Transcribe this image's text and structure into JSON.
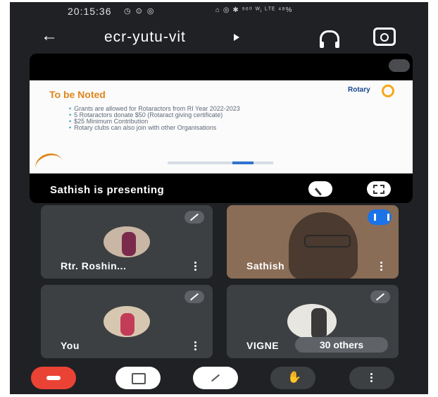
{
  "status_bar": {
    "time": "20:15:36",
    "left_icons": "◷ ⊙ ◎",
    "right_icons": "⌂ ◎ ✱ ⁹⁶⁰ ᵂᵢ ᴸᵀᴱ ⁴⁸%"
  },
  "header": {
    "title": "ecr-yutu-vit"
  },
  "presentation": {
    "slide_title": "To be Noted",
    "logo_text": "Rotary",
    "bullets": [
      "Grants are allowed for Rotaractors from RI Year 2022-2023",
      "5 Rotaractors donate $50 (Rotaract giving certificate)",
      "$25 Minimum Contribution",
      "Rotary clubs can also join with other Organisations"
    ],
    "label": "Sathish is presenting"
  },
  "participants": [
    {
      "name": "Rtr. Roshin..."
    },
    {
      "name": "Sathish"
    },
    {
      "name": "You"
    },
    {
      "name": "VIGNE",
      "others": "30 others"
    }
  ]
}
